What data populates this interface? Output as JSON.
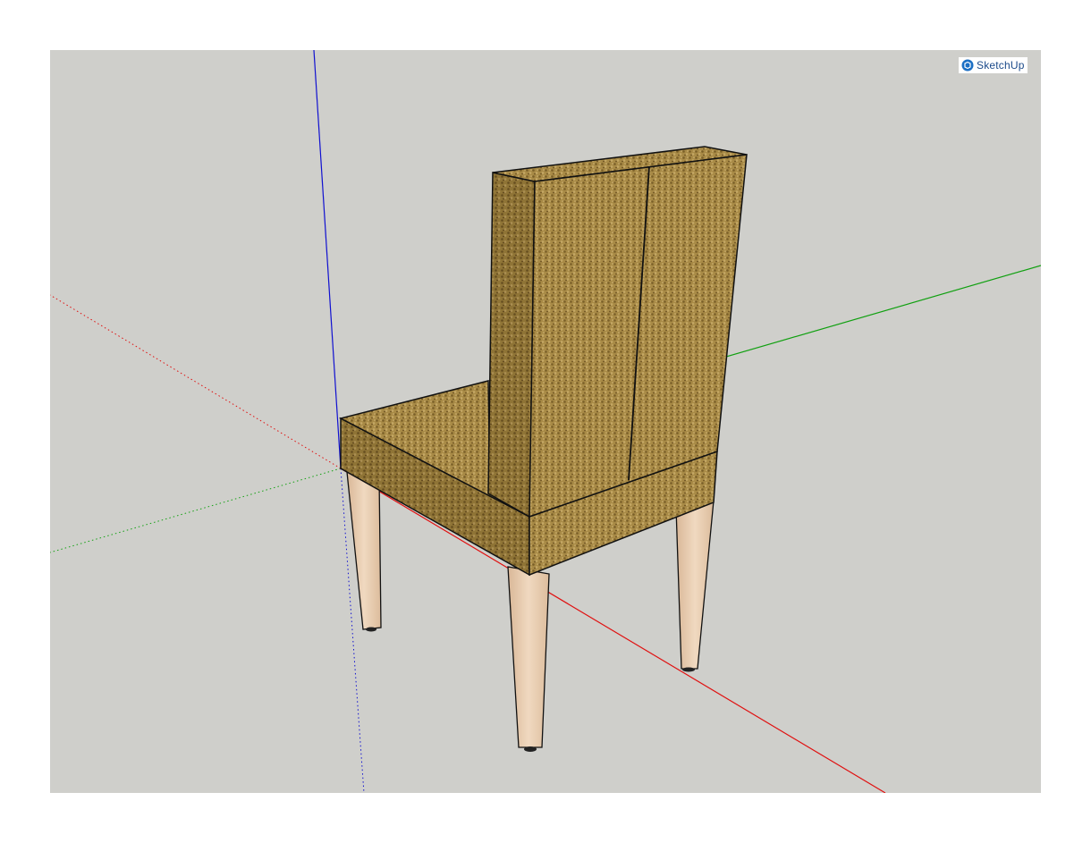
{
  "app": {
    "watermark_text": "SketchUp"
  },
  "scene": {
    "model": "dining-chair",
    "axes": {
      "red": "#e01010",
      "green": "#10a010",
      "blue": "#1010d0"
    },
    "background_color": "#cfcfcb",
    "sky_color": "#ffffff",
    "fabric_color": "#a88a46",
    "leg_color": "#e6c7a7",
    "edge_color": "#111111"
  }
}
